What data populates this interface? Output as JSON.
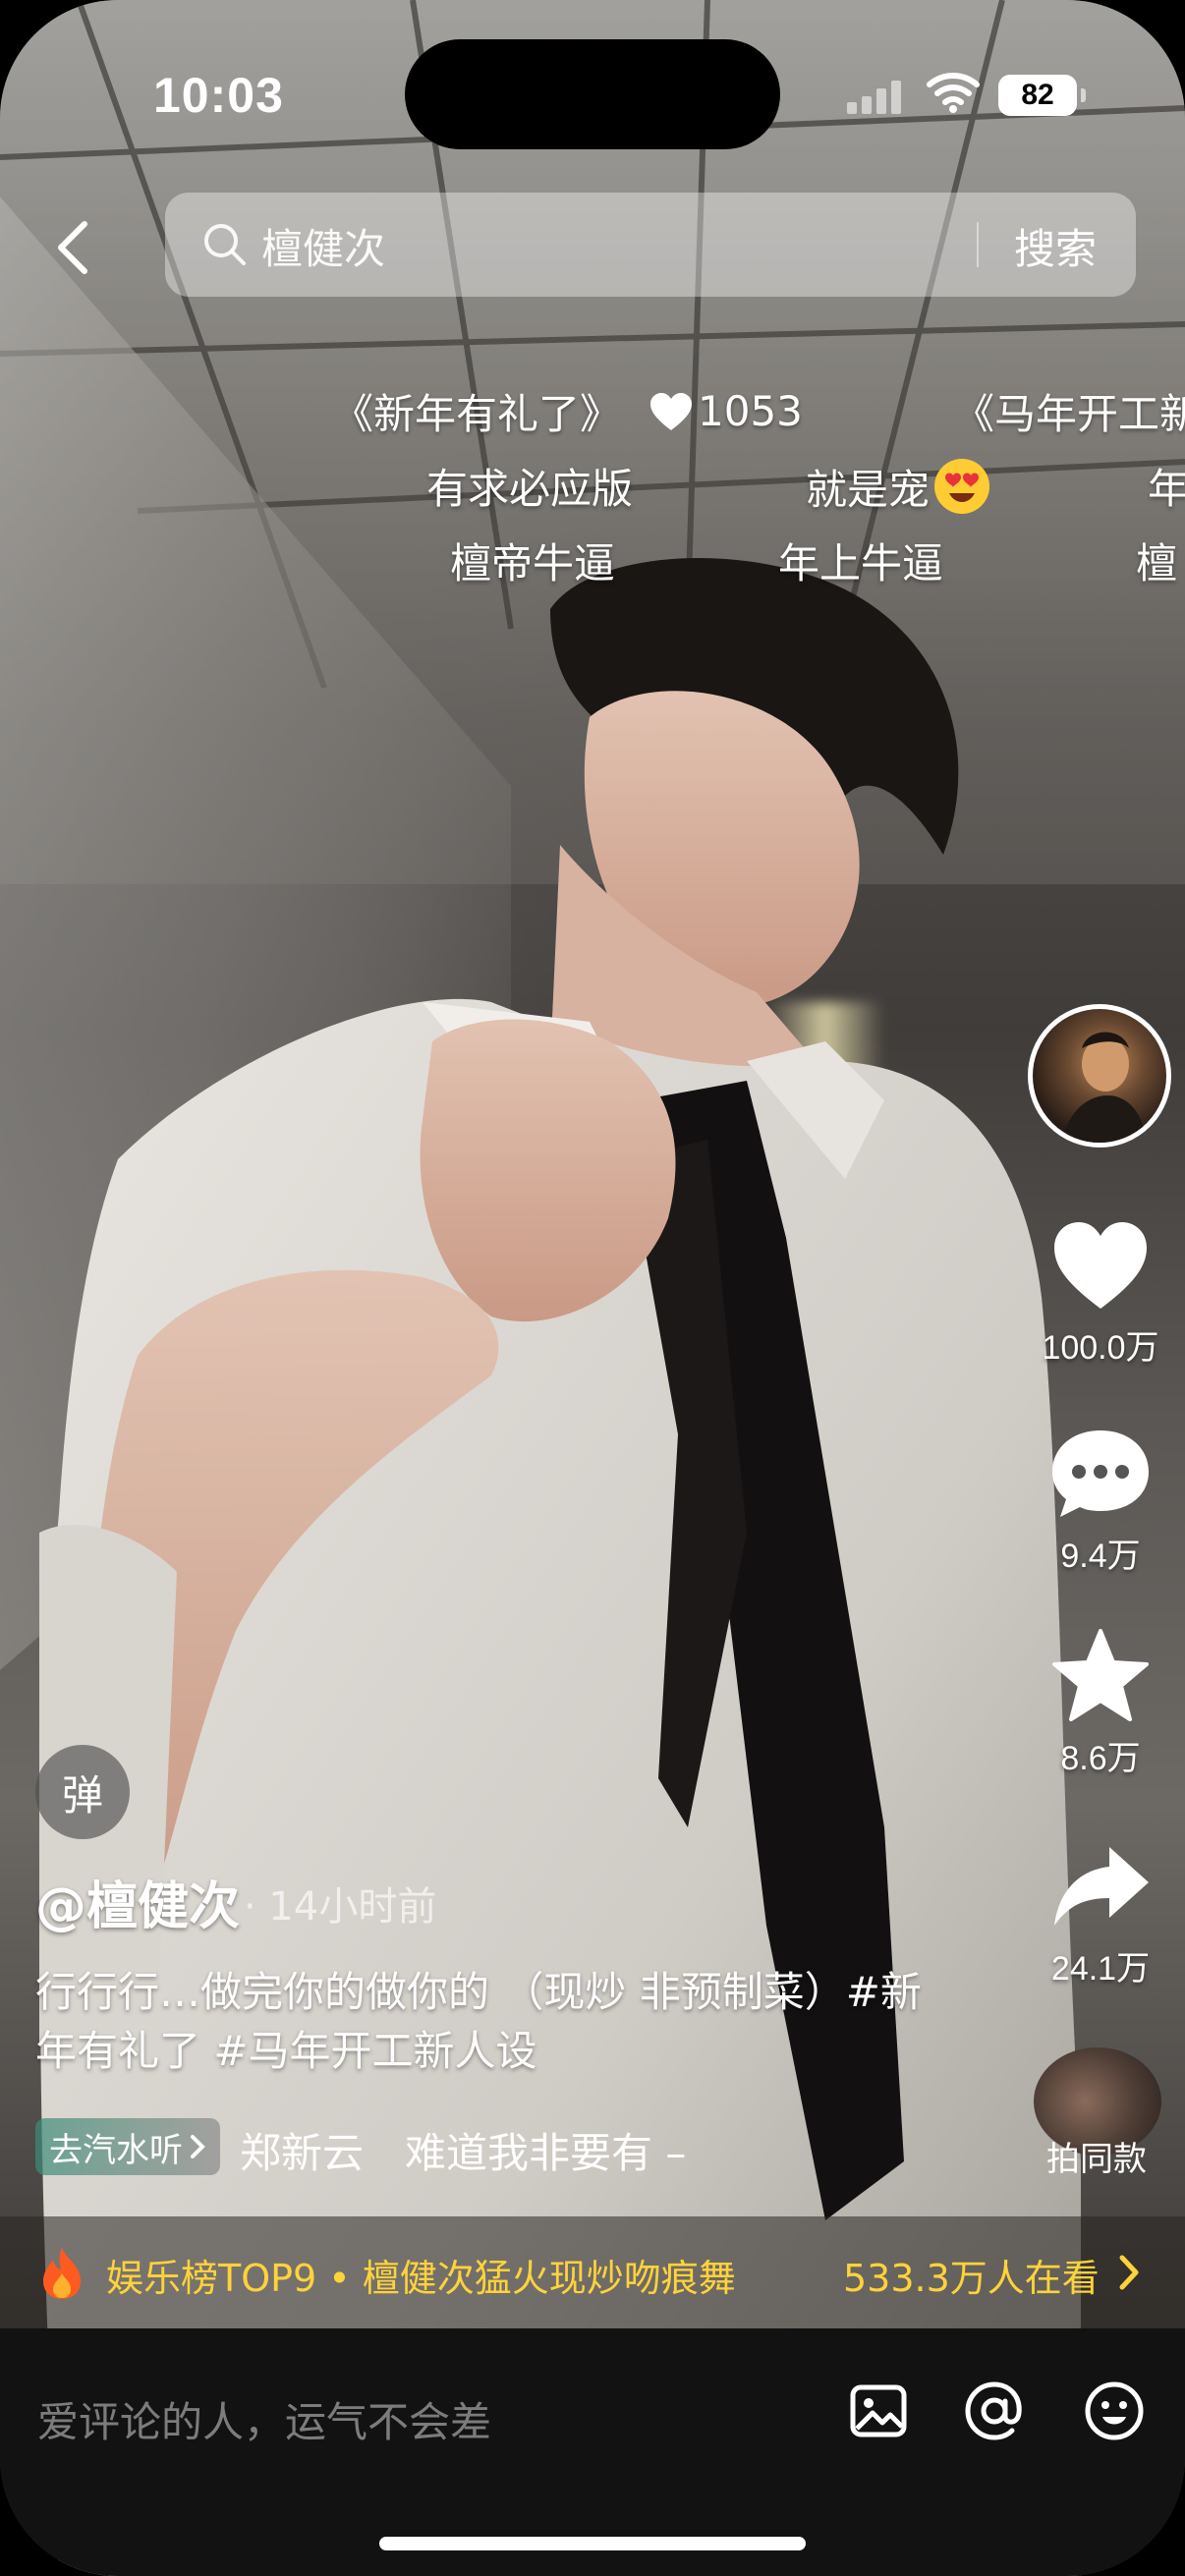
{
  "status_bar": {
    "time": "10:03",
    "battery": "82"
  },
  "search": {
    "query": "檀健次",
    "button_label": "搜索"
  },
  "danmaku": {
    "row1": [
      "《新年有礼了》",
      "1053",
      "《马年开工新"
    ],
    "row2": [
      "有求必应版",
      "就是宠",
      "年"
    ],
    "row3": [
      "檀帝牛逼",
      "年上牛逼",
      "檀"
    ]
  },
  "actions": {
    "likes": "100.0万",
    "comments": "9.4万",
    "favorites": "8.6万",
    "shares": "24.1万",
    "same_style": "拍同款"
  },
  "danmu_toggle": "弹",
  "post": {
    "author": "@檀健次",
    "time": "· 14小时前",
    "caption": "行行行…做完你的做你的 （现炒 非预制菜）#新年有礼了 #马年开工新人设",
    "music_chip": "去汽水听",
    "music_text": "郑新云　难道我非要有 –"
  },
  "hot_banner": {
    "text": "娱乐榜TOP9 • 檀健次猛火现炒吻痕舞",
    "viewers": "533.3万人在看"
  },
  "comment_bar": {
    "placeholder": "爱评论的人，运气不会差"
  },
  "colors": {
    "accent_yellow": "#ffd33a",
    "comment_bar_bg": "#121212"
  },
  "icons": [
    "back-icon",
    "search-icon",
    "heart-icon",
    "comment-icon",
    "star-icon",
    "share-icon",
    "fire-icon",
    "chevron-right-icon",
    "image-icon",
    "at-icon",
    "emoji-icon"
  ]
}
